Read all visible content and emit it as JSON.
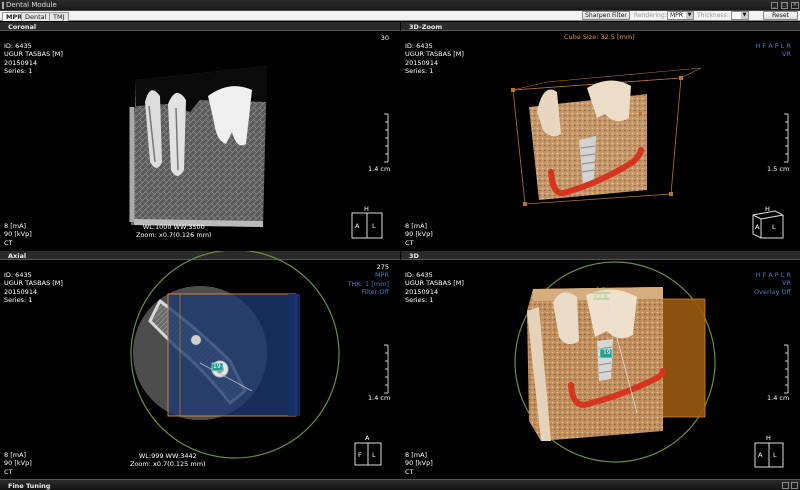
{
  "window": {
    "title": "Dental Module"
  },
  "tabs": [
    {
      "label": "MPR"
    },
    {
      "label": "Dental"
    },
    {
      "label": "TMJ"
    }
  ],
  "toolbar": {
    "sharpen_label": "Sharpen Filter",
    "rendering_label": "Rendering:",
    "rendering_value": "MPR",
    "thickness_label": "Thickness:",
    "thickness_value": "",
    "reset_label": "Reset"
  },
  "patient": {
    "id": "ID: 6435",
    "name": "UGUR TASBAS [M]",
    "date": "20150914",
    "series": "Series: 1",
    "ma": "8 [mA]",
    "kvp": "90 [kVp]",
    "modality": "CT"
  },
  "panes": {
    "coronal": {
      "title": "Coronal",
      "slice": "30",
      "wlww": "WL:1000 WW:3500",
      "zoom": "Zoom: x0.7(0.126 mm)",
      "scale": "1.4 cm"
    },
    "zoom3d": {
      "title": "3D-Zoom",
      "cube_size": "Cube Size: 32.5 [mm]",
      "orient": "H F A P L R",
      "mode": "VR",
      "scale": "1.5 cm"
    },
    "axial": {
      "title": "Axial",
      "slice": "275",
      "mode": "MPR",
      "thk": "THK: 1 [mm]",
      "filter": "Filter Off",
      "wlww": "WL:999 WW:3442",
      "zoom": "Zoom: x0.7(0.125 mm)",
      "scale": "1.4 cm",
      "implant_label": "19"
    },
    "v3d": {
      "title": "3D",
      "orient": "H F A P L R",
      "mode": "VR",
      "overlay": "Overlay Off",
      "scale": "1.4 cm",
      "measure1": "3.7",
      "measure2": "12.0",
      "implant_label": "19"
    }
  },
  "cube_labels": {
    "h": "H",
    "a": "A",
    "l": "L",
    "f": "F"
  },
  "statusbar": {
    "label": "Fine Tuning"
  },
  "colors": {
    "blue_text": "#4a7fc8",
    "orange_text": "#e58b2a",
    "circle": "#6a8f3a",
    "nerve": "#d6341f",
    "roi": "#d9822b"
  }
}
